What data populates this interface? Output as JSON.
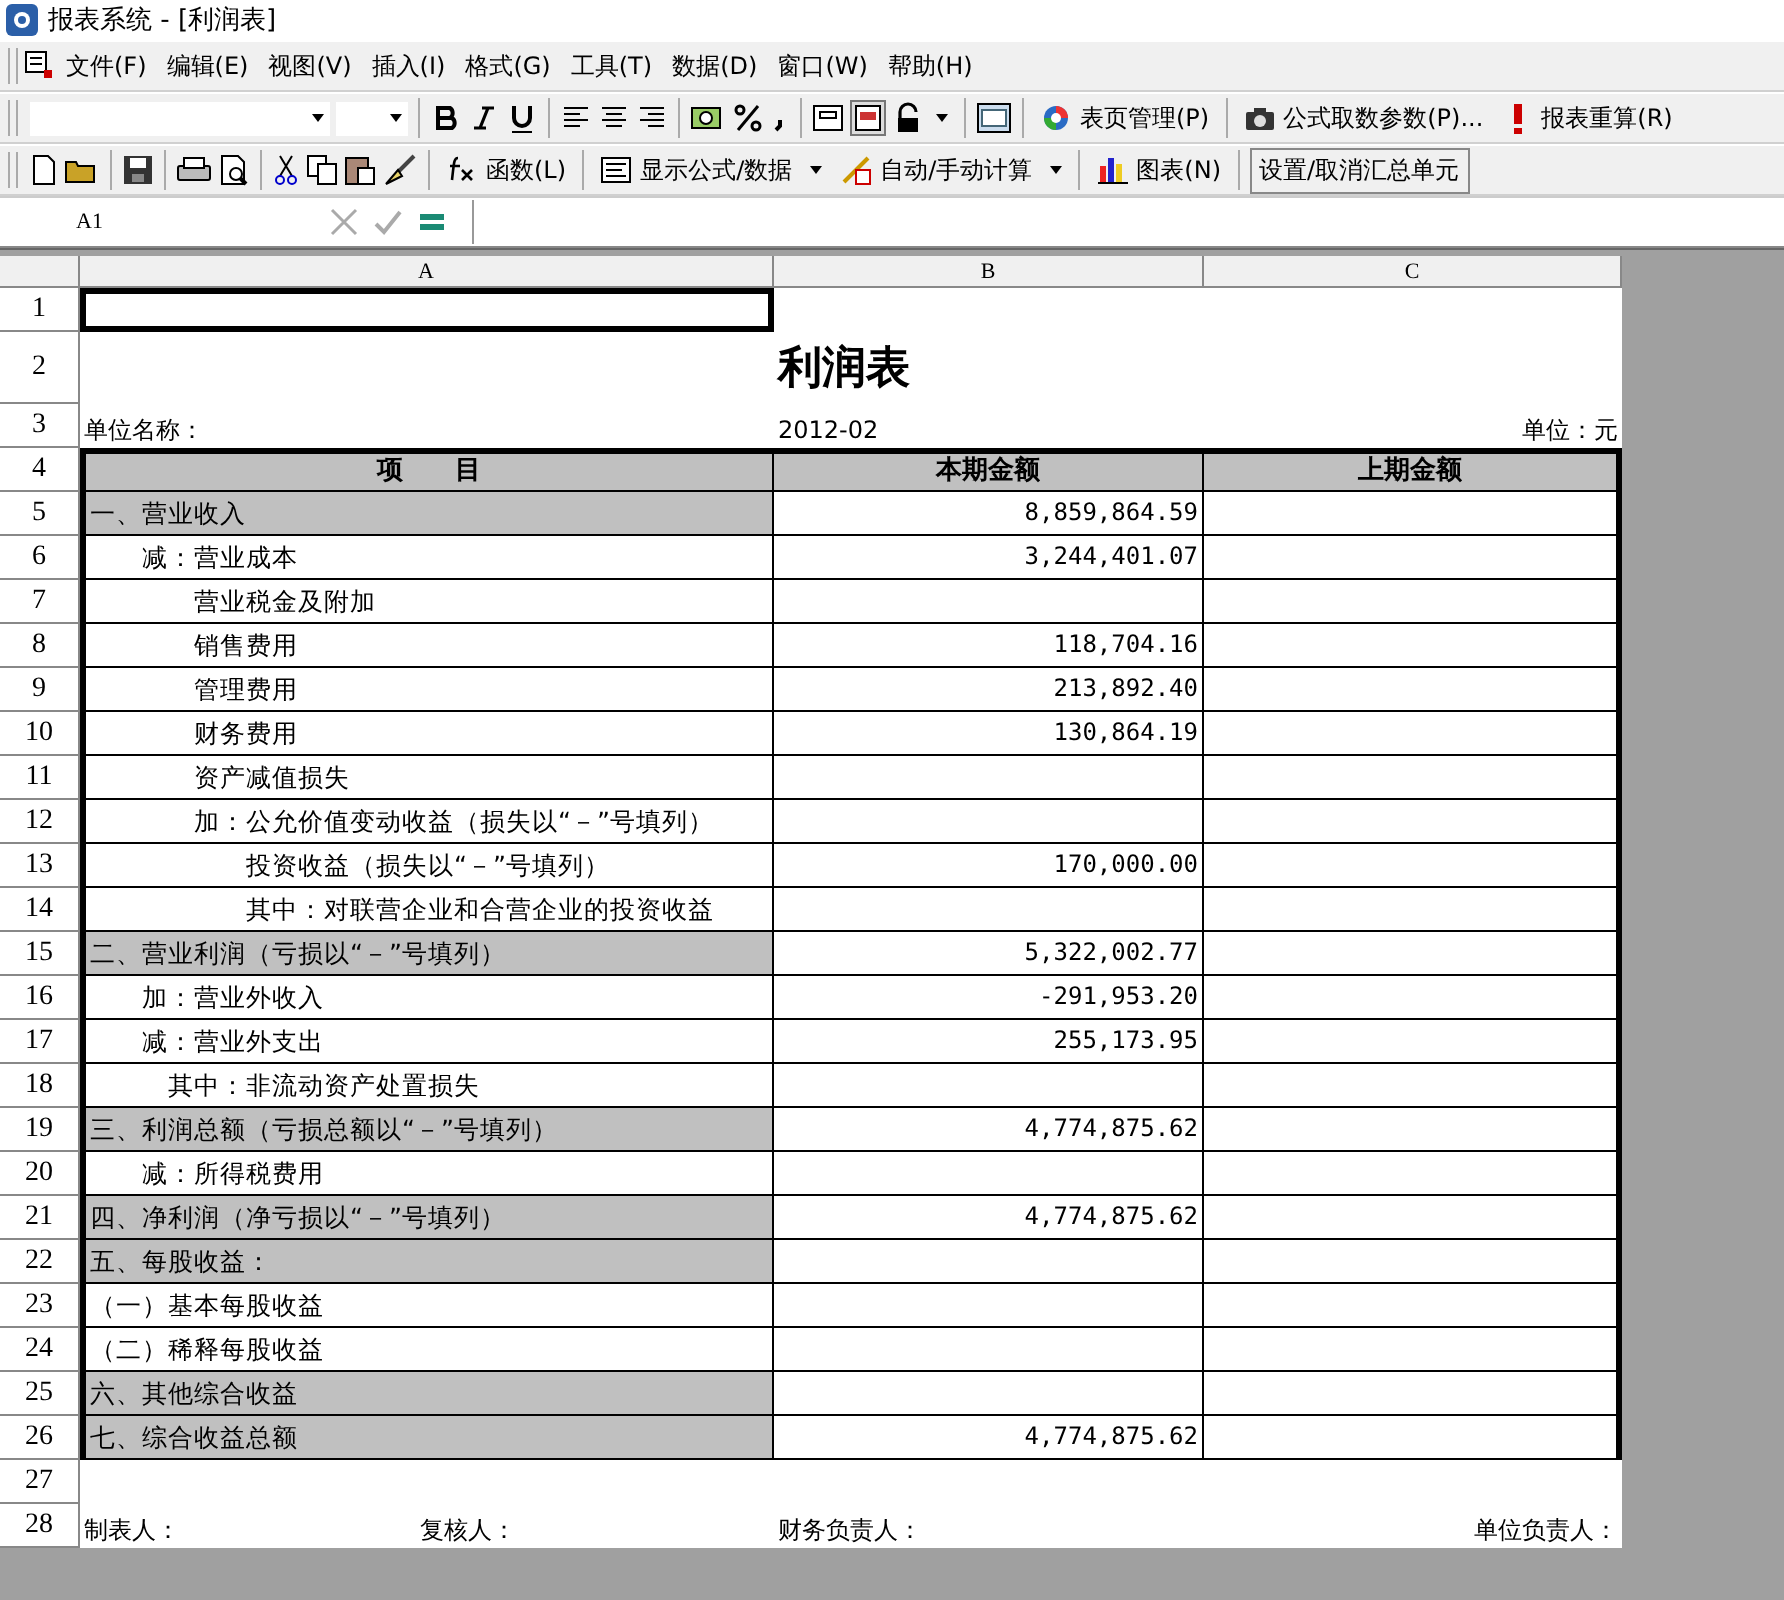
{
  "window": {
    "title": "报表系统 - [利润表]"
  },
  "menu": [
    "文件(F)",
    "编辑(E)",
    "视图(V)",
    "插入(I)",
    "格式(G)",
    "工具(T)",
    "数据(D)",
    "窗口(W)",
    "帮助(H)"
  ],
  "format_toolbar": {
    "buttons": [
      "表页管理(P)",
      "公式取数参数(P)...",
      "报表重算(R)"
    ]
  },
  "standard_toolbar": {
    "buttons": [
      "函数(L)",
      "显示公式/数据",
      "自动/手动计算",
      "图表(N)",
      "设置/取消汇总单元"
    ]
  },
  "formula_bar": {
    "cell_ref": "A1"
  },
  "columns": [
    "A",
    "B",
    "C"
  ],
  "rows": [
    {
      "number": "1",
      "kind": "blank",
      "cells": [
        "",
        "",
        ""
      ]
    },
    {
      "number": "2",
      "kind": "title",
      "cells": [
        "",
        "利润表",
        ""
      ]
    },
    {
      "number": "3",
      "kind": "info",
      "cells": [
        "单位名称：",
        "2012-02",
        "单位：元"
      ]
    },
    {
      "number": "4",
      "kind": "header",
      "cells": [
        "项　　目",
        "本期金额",
        "上期金额"
      ]
    },
    {
      "number": "5",
      "kind": "item",
      "shaded": true,
      "cells": [
        "一、营业收入",
        "8,859,864.59",
        ""
      ]
    },
    {
      "number": "6",
      "kind": "item",
      "shaded": false,
      "cells": [
        "　　减：营业成本",
        "3,244,401.07",
        ""
      ]
    },
    {
      "number": "7",
      "kind": "item",
      "shaded": false,
      "cells": [
        "　　　　营业税金及附加",
        "",
        ""
      ]
    },
    {
      "number": "8",
      "kind": "item",
      "shaded": false,
      "cells": [
        "　　　　销售费用",
        "118,704.16",
        ""
      ]
    },
    {
      "number": "9",
      "kind": "item",
      "shaded": false,
      "cells": [
        "　　　　管理费用",
        "213,892.40",
        ""
      ]
    },
    {
      "number": "10",
      "kind": "item",
      "shaded": false,
      "cells": [
        "　　　　财务费用",
        "130,864.19",
        ""
      ]
    },
    {
      "number": "11",
      "kind": "item",
      "shaded": false,
      "cells": [
        "　　　　资产减值损失",
        "",
        ""
      ]
    },
    {
      "number": "12",
      "kind": "item",
      "shaded": false,
      "cells": [
        "　　　　加：公允价值变动收益（损失以“－”号填列）",
        "",
        ""
      ]
    },
    {
      "number": "13",
      "kind": "item",
      "shaded": false,
      "cells": [
        "　　　　　　投资收益（损失以“－”号填列）",
        "170,000.00",
        ""
      ]
    },
    {
      "number": "14",
      "kind": "item",
      "shaded": false,
      "cells": [
        "　　　　　　其中：对联营企业和合营企业的投资收益",
        "",
        ""
      ]
    },
    {
      "number": "15",
      "kind": "item",
      "shaded": true,
      "cells": [
        "二、营业利润（亏损以“－”号填列）",
        "5,322,002.77",
        ""
      ]
    },
    {
      "number": "16",
      "kind": "item",
      "shaded": false,
      "cells": [
        "　　加：营业外收入",
        "-291,953.20",
        ""
      ]
    },
    {
      "number": "17",
      "kind": "item",
      "shaded": false,
      "cells": [
        "　　减：营业外支出",
        "255,173.95",
        ""
      ]
    },
    {
      "number": "18",
      "kind": "item",
      "shaded": false,
      "cells": [
        "　　　其中：非流动资产处置损失",
        "",
        ""
      ]
    },
    {
      "number": "19",
      "kind": "item",
      "shaded": true,
      "cells": [
        "三、利润总额（亏损总额以“－”号填列）",
        "4,774,875.62",
        ""
      ]
    },
    {
      "number": "20",
      "kind": "item",
      "shaded": false,
      "cells": [
        "　　减：所得税费用",
        "",
        ""
      ]
    },
    {
      "number": "21",
      "kind": "item",
      "shaded": true,
      "cells": [
        "四、净利润（净亏损以“－”号填列）",
        "4,774,875.62",
        ""
      ]
    },
    {
      "number": "22",
      "kind": "item",
      "shaded": true,
      "cells": [
        "五、每股收益：",
        "",
        ""
      ]
    },
    {
      "number": "23",
      "kind": "item",
      "shaded": false,
      "cells": [
        "（一）基本每股收益",
        "",
        ""
      ]
    },
    {
      "number": "24",
      "kind": "item",
      "shaded": false,
      "cells": [
        "（二）稀释每股收益",
        "",
        ""
      ]
    },
    {
      "number": "25",
      "kind": "item",
      "shaded": true,
      "cells": [
        "六、其他综合收益",
        "",
        ""
      ]
    },
    {
      "number": "26",
      "kind": "item",
      "shaded": true,
      "cells": [
        "七、综合收益总额",
        "4,774,875.62",
        ""
      ]
    },
    {
      "number": "27",
      "kind": "blank",
      "cells": [
        "",
        "",
        ""
      ]
    },
    {
      "number": "28",
      "kind": "footer",
      "cells": [
        "制表人：　　　　　　　　　　复核人：",
        "财务负责人：",
        "单位负责人："
      ]
    }
  ]
}
